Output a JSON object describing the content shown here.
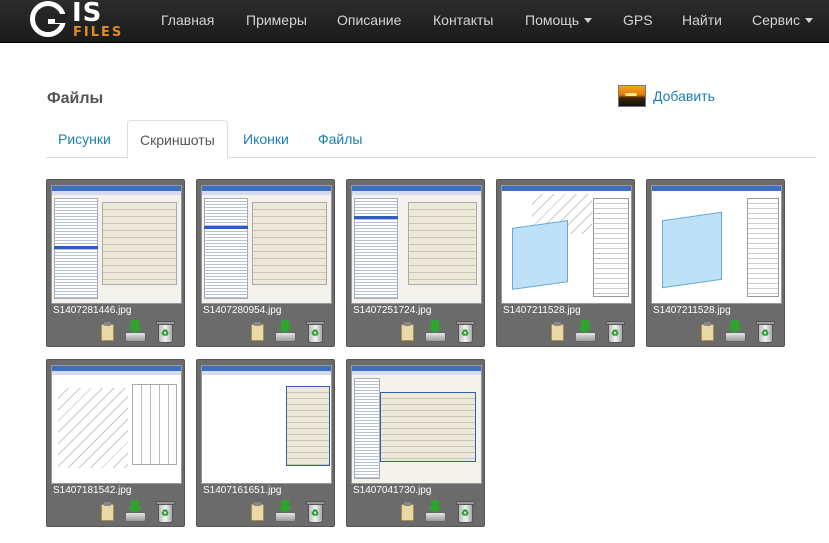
{
  "navbar": {
    "logo_big": "IS",
    "logo_small": "FILES",
    "items": [
      {
        "label": "Главная"
      },
      {
        "label": "Примеры"
      },
      {
        "label": "Описание"
      },
      {
        "label": "Контакты"
      },
      {
        "label": "Помощь",
        "dropdown": true
      },
      {
        "label": "GPS"
      },
      {
        "label": "Найти"
      },
      {
        "label": "Сервис",
        "dropdown": true
      }
    ]
  },
  "page": {
    "title": "Файлы",
    "add_label": "Добавить"
  },
  "tabs": [
    {
      "label": "Рисунки",
      "active": false
    },
    {
      "label": "Скриншоты",
      "active": true
    },
    {
      "label": "Иконки",
      "active": false
    },
    {
      "label": "Файлы",
      "active": false
    }
  ],
  "files": [
    {
      "name": "S1407281446.jpg"
    },
    {
      "name": "S1407280954.jpg"
    },
    {
      "name": "S1407251724.jpg"
    },
    {
      "name": "S1407211528.jpg"
    },
    {
      "name": "S1407211528.jpg"
    },
    {
      "name": "S1407181542.jpg"
    },
    {
      "name": "S1407161651.jpg"
    },
    {
      "name": "S1407041730.jpg"
    }
  ],
  "colors": {
    "navbar": "#1b1b1b",
    "link": "#1a7fae",
    "card": "#6b6b6b",
    "logo_accent": "#e8891a"
  },
  "icons": {
    "copy": "clipboard-icon",
    "download": "download-icon",
    "delete": "recycle-bin-icon"
  }
}
